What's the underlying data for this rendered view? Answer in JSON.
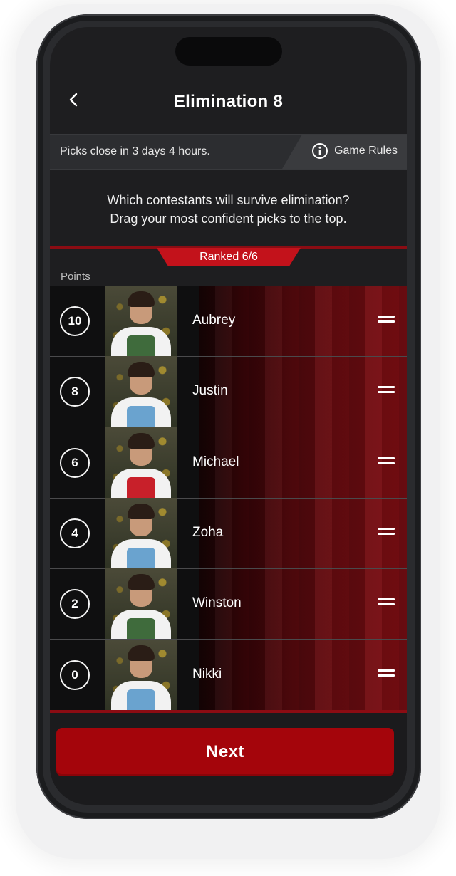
{
  "header": {
    "title": "Elimination 8"
  },
  "info_bar": {
    "picks_close": "Picks close in 3 days 4 hours.",
    "rules_label": "Game Rules"
  },
  "question": {
    "line1": "Which contestants will survive elimination?",
    "line2": "Drag your most confident picks to the top."
  },
  "ranked_label": "Ranked 6/6",
  "points_label": "Points",
  "contestants": [
    {
      "points": "10",
      "name": "Aubrey",
      "apron_color": "#3f6b3c"
    },
    {
      "points": "8",
      "name": "Justin",
      "apron_color": "#6aa3cf"
    },
    {
      "points": "6",
      "name": "Michael",
      "apron_color": "#c8202a"
    },
    {
      "points": "4",
      "name": "Zoha",
      "apron_color": "#6aa3cf"
    },
    {
      "points": "2",
      "name": "Winston",
      "apron_color": "#3f6b3c"
    },
    {
      "points": "0",
      "name": "Nikki",
      "apron_color": "#6aa3cf"
    }
  ],
  "footer": {
    "next_label": "Next"
  },
  "colors": {
    "accent": "#a4050b",
    "badge": "#c3121b",
    "background": "#1e1e20"
  },
  "icons": {
    "back": "chevron-left-icon",
    "rules": "info-icon",
    "drag": "drag-handle-icon"
  }
}
